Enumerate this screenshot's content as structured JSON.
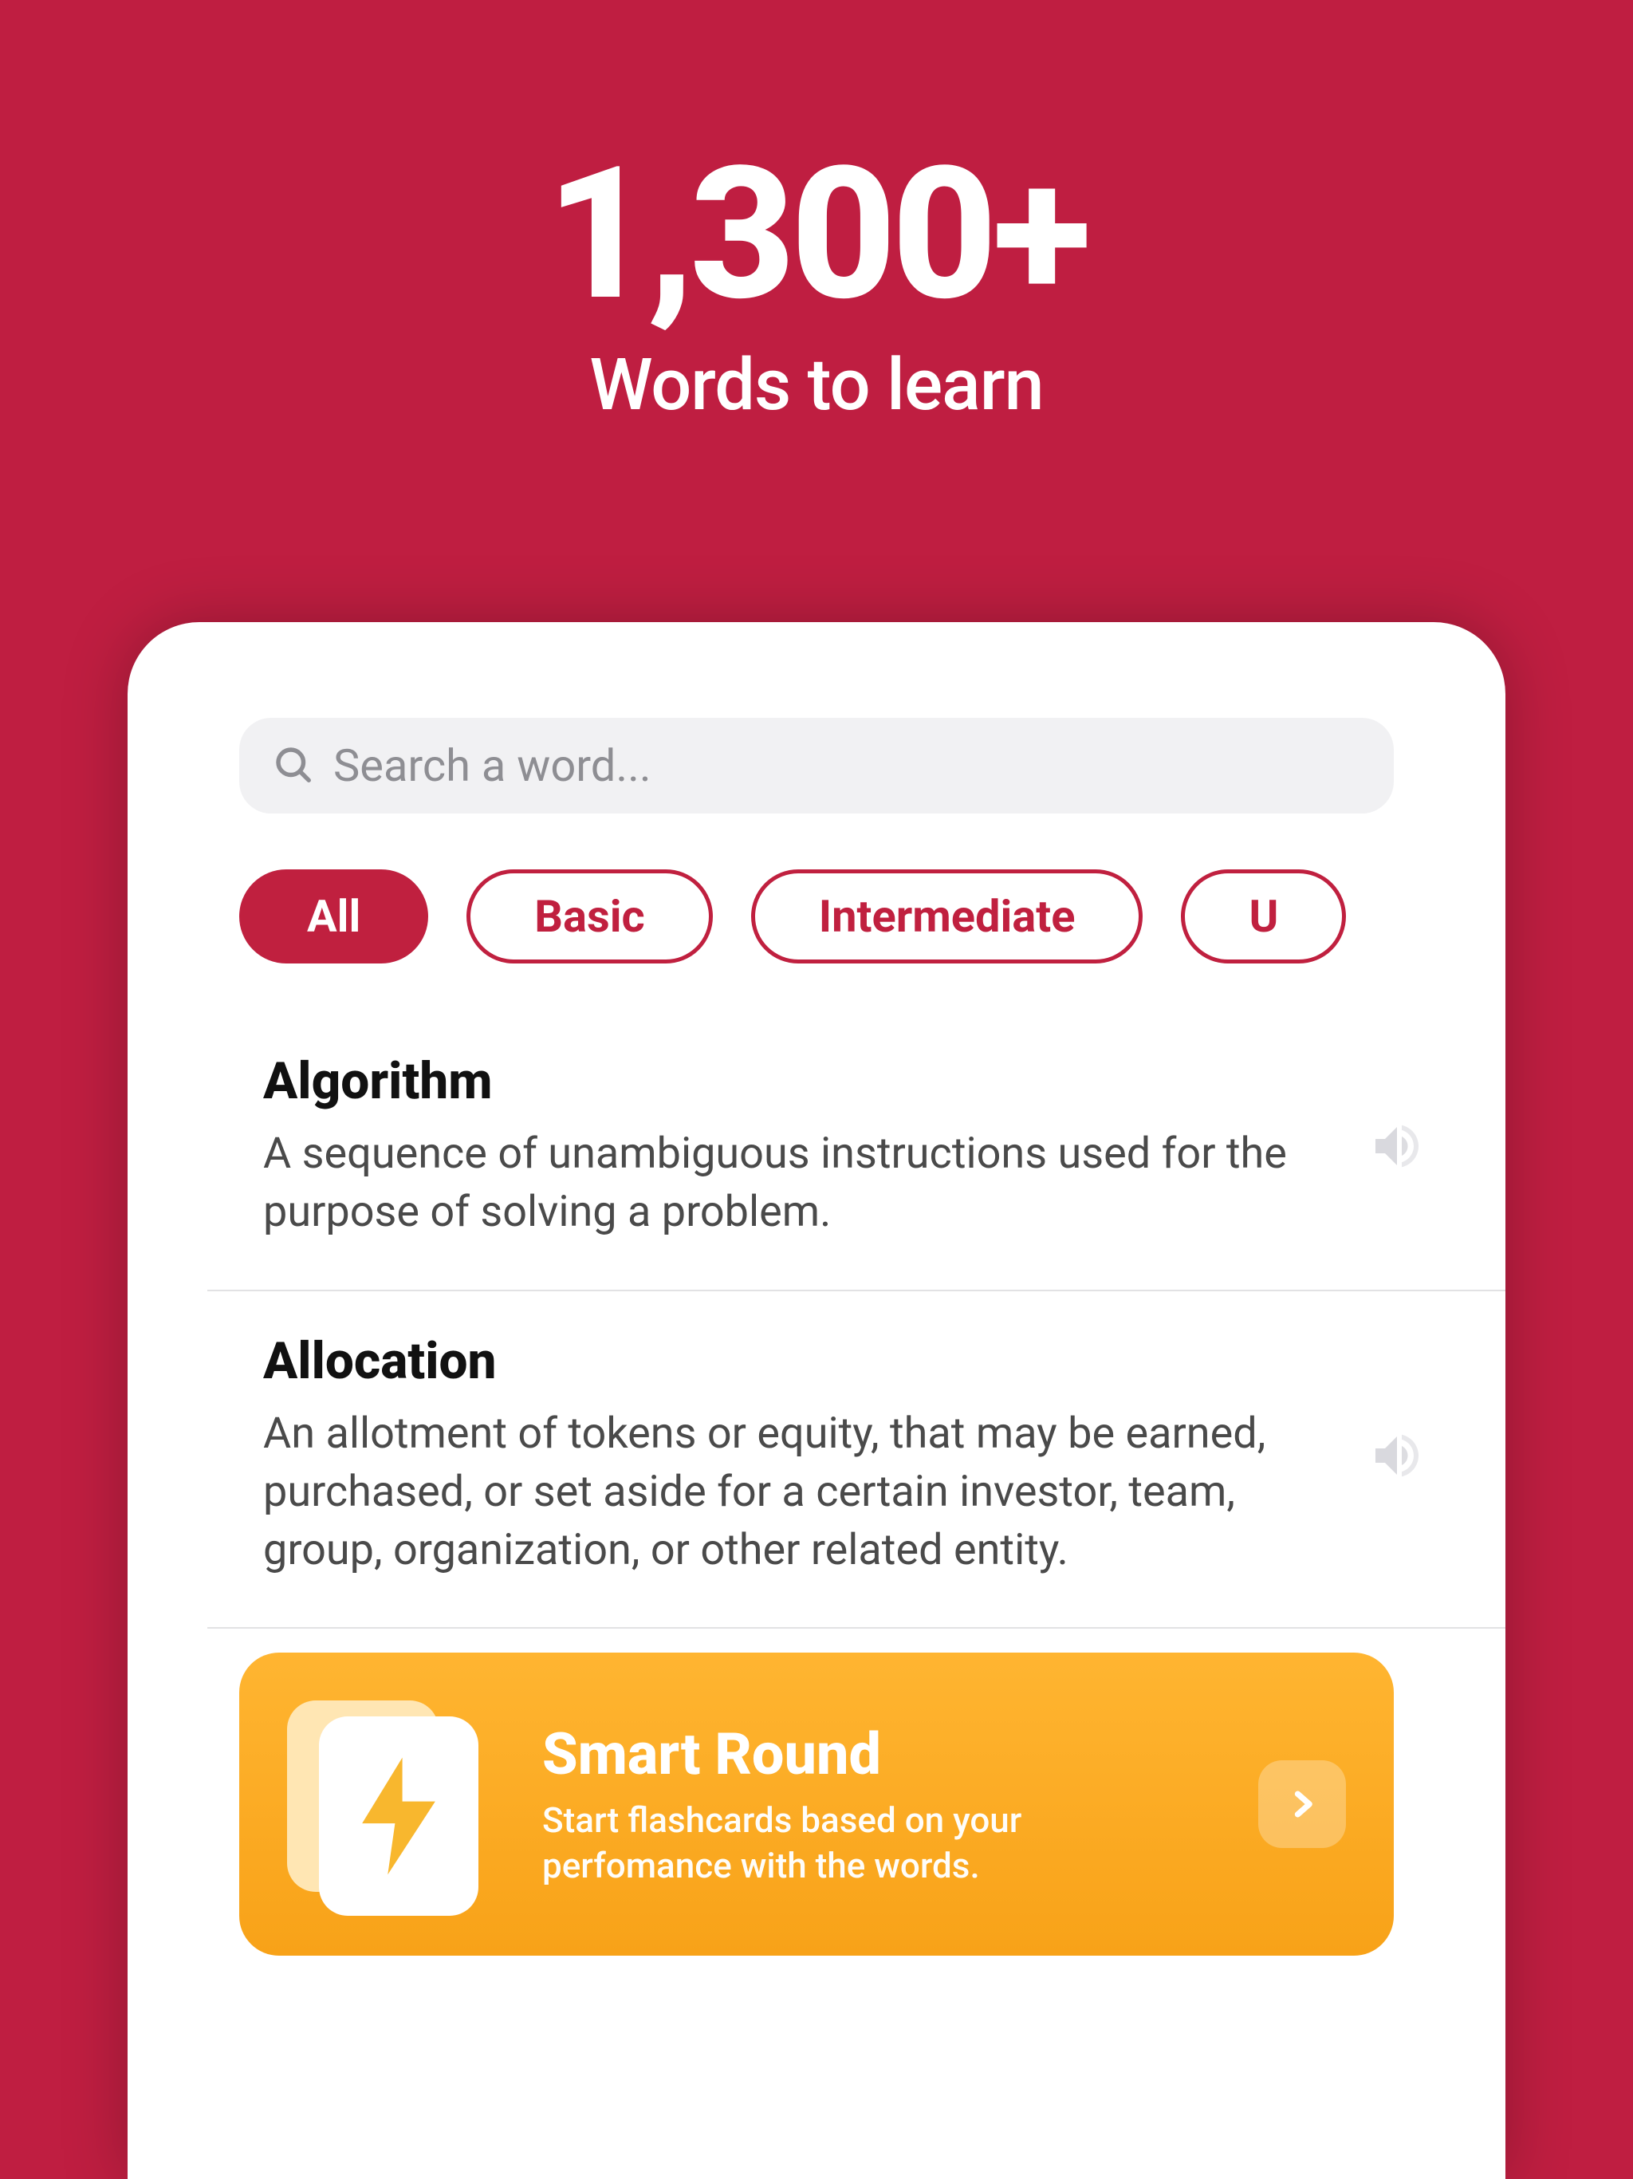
{
  "hero": {
    "count": "1,300+",
    "subtitle": "Words to learn"
  },
  "search": {
    "placeholder": "Search a word..."
  },
  "filters": [
    {
      "label": "All",
      "active": true
    },
    {
      "label": "Basic",
      "active": false
    },
    {
      "label": "Intermediate",
      "active": false
    },
    {
      "label": "U",
      "active": false
    }
  ],
  "words": [
    {
      "term": "Algorithm",
      "definition": "A sequence of unambiguous instructions used for the purpose of solving a problem."
    },
    {
      "term": "Allocation",
      "definition": "An allotment of tokens or equity, that may be earned, purchased, or set aside for a certain investor, team, group, organization, or other related entity."
    }
  ],
  "promo": {
    "title": "Smart Round",
    "subtitle": "Start flashcards based on your perfomance with the words."
  }
}
